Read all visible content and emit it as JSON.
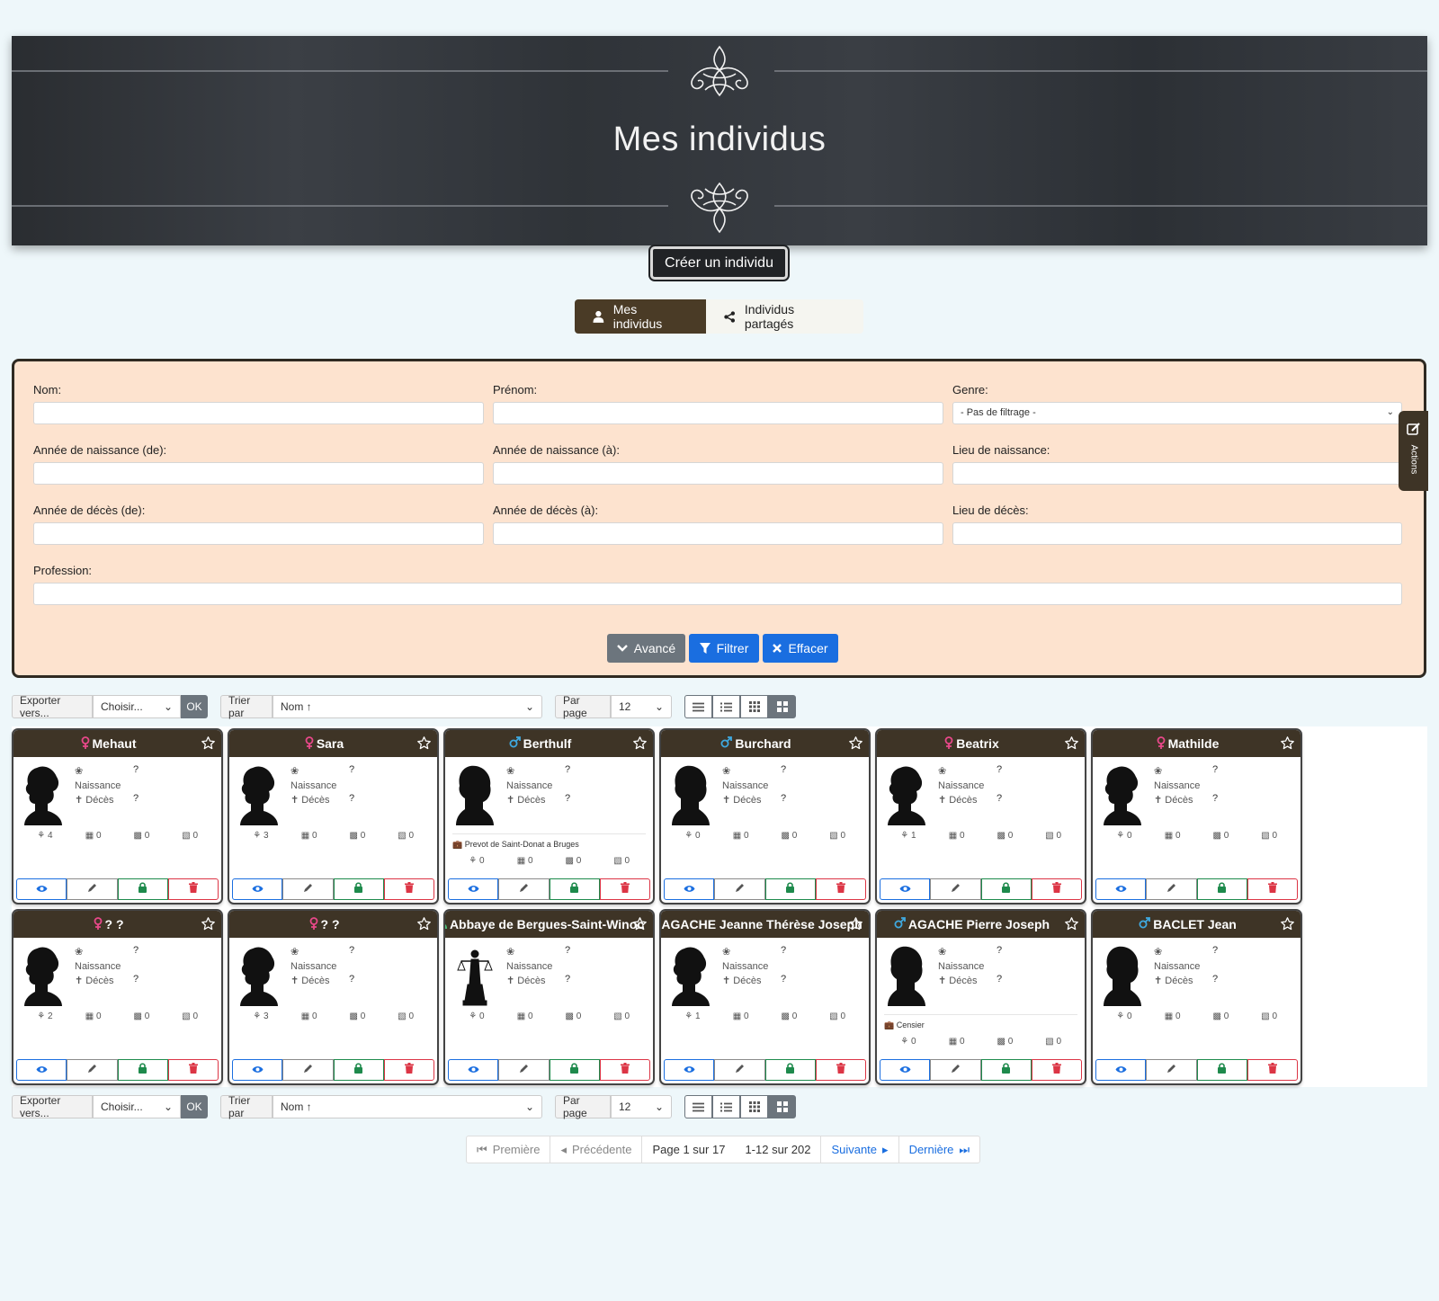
{
  "banner": {
    "title": "Mes individus"
  },
  "create_button": "Créer un individu",
  "tabs": [
    {
      "label": "Mes individus",
      "icon": "user-icon",
      "active": true
    },
    {
      "label": "Individus partagés",
      "icon": "share-icon",
      "active": false
    }
  ],
  "filter": {
    "nom": "Nom:",
    "prenom": "Prénom:",
    "genre": "Genre:",
    "genre_value": "- Pas de filtrage -",
    "naissance_de": "Année de naissance (de):",
    "naissance_a": "Année de naissance (à):",
    "lieu_naissance": "Lieu de naissance:",
    "deces_de": "Année de décès (de):",
    "deces_a": "Année de décès (à):",
    "lieu_deces": "Lieu de décès:",
    "profession": "Profession:",
    "btn_avance": "Avancé",
    "btn_filtrer": "Filtrer",
    "btn_effacer": "Effacer",
    "colors": {
      "avance": "#6c757d",
      "filtrer": "#1a6ee0",
      "effacer": "#1a6ee0"
    }
  },
  "actions_tab": "Actions",
  "toolbar": {
    "export_label": "Exporter vers...",
    "export_value": "Choisir...",
    "ok": "OK",
    "sort_label": "Trier par",
    "sort_value": "Nom ↑",
    "perpage_label": "Par page",
    "perpage_value": "12"
  },
  "cards": [
    {
      "name": "Mehaut",
      "gender": "female",
      "naissance": "Naissance",
      "deces": "Décès",
      "q1": "?",
      "q2": "?",
      "children": "4",
      "events": "0",
      "places": "0",
      "sources": "0",
      "profession": "",
      "photo": "female"
    },
    {
      "name": "Sara",
      "gender": "female",
      "naissance": "Naissance",
      "deces": "Décès",
      "q1": "?",
      "q2": "?",
      "children": "3",
      "events": "0",
      "places": "0",
      "sources": "0",
      "profession": "",
      "photo": "female"
    },
    {
      "name": "Berthulf",
      "gender": "male",
      "naissance": "Naissance",
      "deces": "Décès",
      "q1": "?",
      "q2": "?",
      "children": "0",
      "events": "0",
      "places": "0",
      "sources": "0",
      "profession": "Prevot de Saint-Donat a Bruges",
      "photo": "male"
    },
    {
      "name": "Burchard",
      "gender": "male",
      "naissance": "Naissance",
      "deces": "Décès",
      "q1": "?",
      "q2": "?",
      "children": "0",
      "events": "0",
      "places": "0",
      "sources": "0",
      "profession": "",
      "photo": "male"
    },
    {
      "name": "Beatrix",
      "gender": "female",
      "naissance": "Naissance",
      "deces": "Décès",
      "q1": "?",
      "q2": "?",
      "children": "1",
      "events": "0",
      "places": "0",
      "sources": "0",
      "profession": "",
      "photo": "female"
    },
    {
      "name": "Mathilde",
      "gender": "female",
      "naissance": "Naissance",
      "deces": "Décès",
      "q1": "?",
      "q2": "?",
      "children": "0",
      "events": "0",
      "places": "0",
      "sources": "0",
      "profession": "",
      "photo": "female"
    },
    {
      "name": "? ?",
      "gender": "female",
      "naissance": "Naissance",
      "deces": "Décès",
      "q1": "?",
      "q2": "?",
      "children": "2",
      "events": "0",
      "places": "0",
      "sources": "0",
      "profession": "",
      "photo": "female"
    },
    {
      "name": "? ?",
      "gender": "female",
      "naissance": "Naissance",
      "deces": "Décès",
      "q1": "?",
      "q2": "?",
      "children": "3",
      "events": "0",
      "places": "0",
      "sources": "0",
      "profession": "",
      "photo": "female"
    },
    {
      "name": "Abbaye de Bergues-Saint-Winoc",
      "gender": "entity",
      "naissance": "Naissance",
      "deces": "Décès",
      "q1": "?",
      "q2": "?",
      "children": "0",
      "events": "0",
      "places": "0",
      "sources": "0",
      "profession": "",
      "photo": "justice"
    },
    {
      "name": "AGACHE Jeanne Thérèse Joseph",
      "gender": "female",
      "naissance": "Naissance",
      "deces": "Décès",
      "q1": "?",
      "q2": "?",
      "children": "1",
      "events": "0",
      "places": "0",
      "sources": "0",
      "profession": "",
      "photo": "female"
    },
    {
      "name": "AGACHE Pierre Joseph",
      "gender": "male",
      "naissance": "Naissance",
      "deces": "Décès",
      "q1": "?",
      "q2": "?",
      "children": "0",
      "events": "0",
      "places": "0",
      "sources": "0",
      "profession": "Censier",
      "photo": "male"
    },
    {
      "name": "BACLET Jean",
      "gender": "male",
      "naissance": "Naissance",
      "deces": "Décès",
      "q1": "?",
      "q2": "?",
      "children": "0",
      "events": "0",
      "places": "0",
      "sources": "0",
      "profession": "",
      "photo": "male"
    }
  ],
  "gender_colors": {
    "female": "#e8488a",
    "male": "#3fa9e0",
    "entity": "#4cc47a"
  },
  "pager": {
    "first": "Première",
    "prev": "Précédente",
    "page_info": "Page 1 sur 17",
    "range_info": "1-12 sur 202",
    "next": "Suivante",
    "last": "Dernière"
  }
}
